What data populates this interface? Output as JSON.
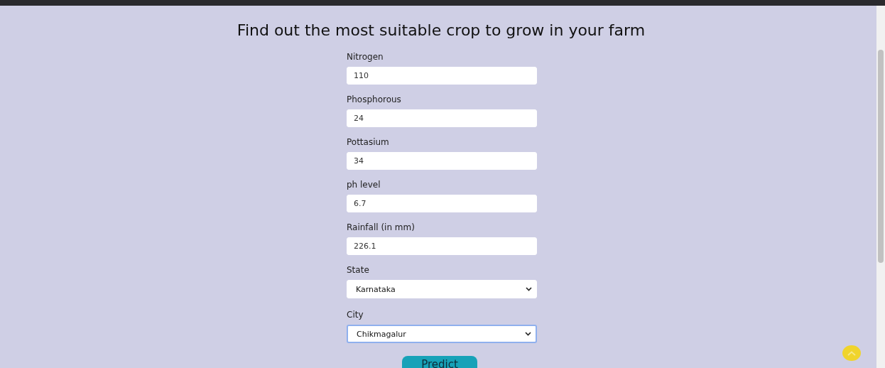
{
  "heading": "Find out the most suitable crop to grow in your farm",
  "fields": [
    {
      "label": "Nitrogen",
      "kind": "input",
      "value": "110",
      "focused": false
    },
    {
      "label": "Phosphorous",
      "kind": "input",
      "value": "24",
      "focused": false
    },
    {
      "label": "Pottasium",
      "kind": "input",
      "value": "34",
      "focused": false
    },
    {
      "label": "ph level",
      "kind": "input",
      "value": "6.7",
      "focused": false
    },
    {
      "label": "Rainfall (in mm)",
      "kind": "input",
      "value": "226.1",
      "focused": false
    },
    {
      "label": "State",
      "kind": "select",
      "value": "Karnataka",
      "focused": false
    },
    {
      "label": "City",
      "kind": "select",
      "value": "Chikmagalur",
      "focused": true
    }
  ],
  "submit": {
    "label": "Predict"
  }
}
